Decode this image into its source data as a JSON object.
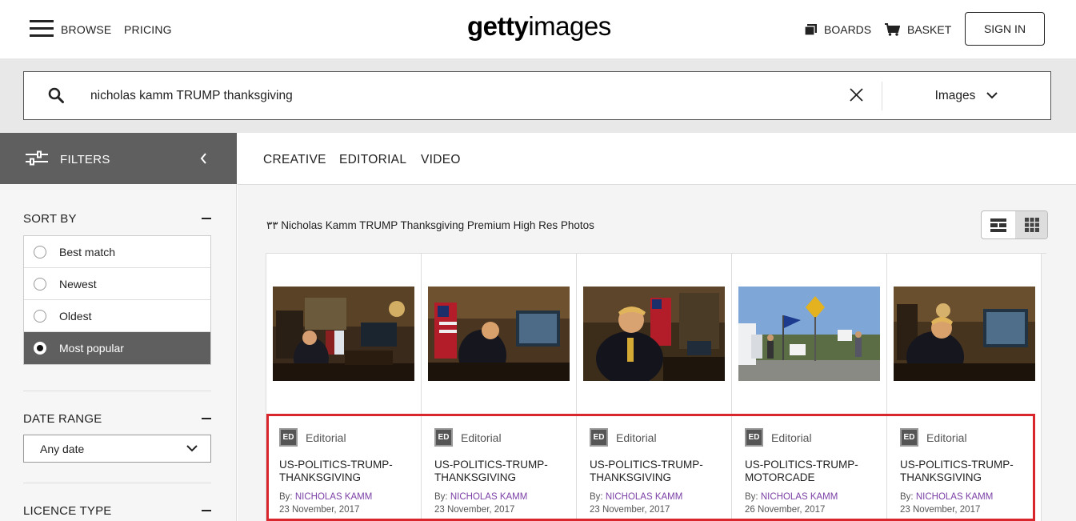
{
  "header": {
    "browse": "BROWSE",
    "pricing": "PRICING",
    "logo_bold": "getty",
    "logo_regular": "images",
    "boards": "BOARDS",
    "basket": "BASKET",
    "sign_in": "SIGN IN"
  },
  "search": {
    "query": "nicholas kamm TRUMP thanksgiving",
    "type": "Images"
  },
  "sidebar": {
    "filters_label": "FILTERS",
    "sort_title": "SORT BY",
    "sort_options": [
      "Best match",
      "Newest",
      "Oldest",
      "Most popular"
    ],
    "sort_selected": "Most popular",
    "date_title": "DATE RANGE",
    "date_value": "Any date",
    "licence_title": "LICENCE TYPE"
  },
  "tabs": [
    "CREATIVE",
    "EDITORIAL",
    "VIDEO"
  ],
  "results": {
    "title": "٣٣ Nicholas Kamm TRUMP Thanksgiving Premium High Res Photos",
    "cards": [
      {
        "badge": "ED",
        "category": "Editorial",
        "title": "US-POLITICS-TRUMP-THANKSGIVING",
        "by_label": "By:",
        "author": "NICHOLAS KAMM",
        "date": "23 November, 2017"
      },
      {
        "badge": "ED",
        "category": "Editorial",
        "title": "US-POLITICS-TRUMP-THANKSGIVING",
        "by_label": "By:",
        "author": "NICHOLAS KAMM",
        "date": "23 November, 2017"
      },
      {
        "badge": "ED",
        "category": "Editorial",
        "title": "US-POLITICS-TRUMP-THANKSGIVING",
        "by_label": "By:",
        "author": "NICHOLAS KAMM",
        "date": "23 November, 2017"
      },
      {
        "badge": "ED",
        "category": "Editorial",
        "title": "US-POLITICS-TRUMP-MOTORCADE",
        "by_label": "By:",
        "author": "NICHOLAS KAMM",
        "date": "26 November, 2017"
      },
      {
        "badge": "ED",
        "category": "Editorial",
        "title": "US-POLITICS-TRUMP-THANKSGIVING",
        "by_label": "By:",
        "author": "NICHOLAS KAMM",
        "date": "23 November, 2017"
      }
    ]
  },
  "colors": {
    "highlight": "#d9262d",
    "author": "#7b3fa6",
    "filters_bar": "#5f5f5f"
  }
}
